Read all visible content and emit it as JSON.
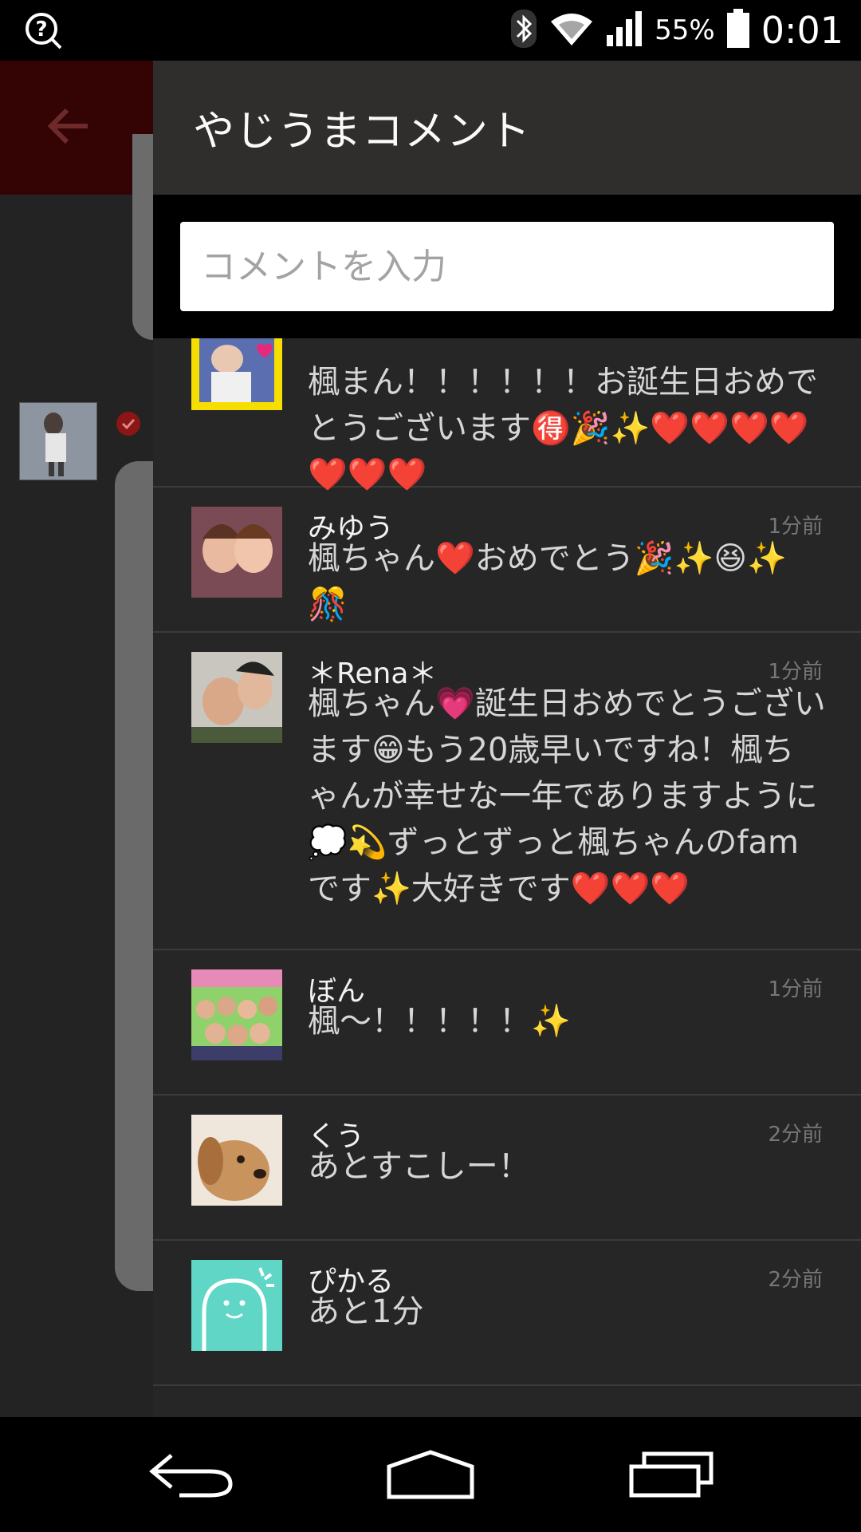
{
  "status_bar": {
    "battery_text": "55%",
    "time": "0:01",
    "icons": [
      "help-icon",
      "bluetooth-icon",
      "wifi-icon",
      "signal-icon",
      "battery-icon"
    ]
  },
  "drawer": {
    "title": "やじうまコメント",
    "input_placeholder": "コメントを入力"
  },
  "comments": [
    {
      "name": "",
      "time": "",
      "text": "楓まん！！！！！！お誕生日おめでとうございます🉐🎉✨❤️❤️❤️❤️❤️❤️❤️"
    },
    {
      "name": "みゆう",
      "time": "1分前",
      "text": "楓ちゃん❤️おめでとう🎉✨😆✨🎊"
    },
    {
      "name": "＊Rena＊",
      "time": "1分前",
      "text": "楓ちゃん💗誕生日おめでとうございます😁もう20歳早いですね！楓ちゃんが幸せな一年でありますように💭💫ずっとずっと楓ちゃんのfamです✨大好きです❤️❤️❤️"
    },
    {
      "name": "ぼん",
      "time": "1分前",
      "text": "楓〜！！！！！✨"
    },
    {
      "name": "くう",
      "time": "2分前",
      "text": "あとすこしー！"
    },
    {
      "name": "ぴかる",
      "time": "2分前",
      "text": "あと1分"
    }
  ],
  "colors": {
    "drawer_bg": "#262626",
    "header_bg": "#302e2d",
    "accent_red": "#8c1616",
    "avatar_teal": "#5fd6c6"
  }
}
